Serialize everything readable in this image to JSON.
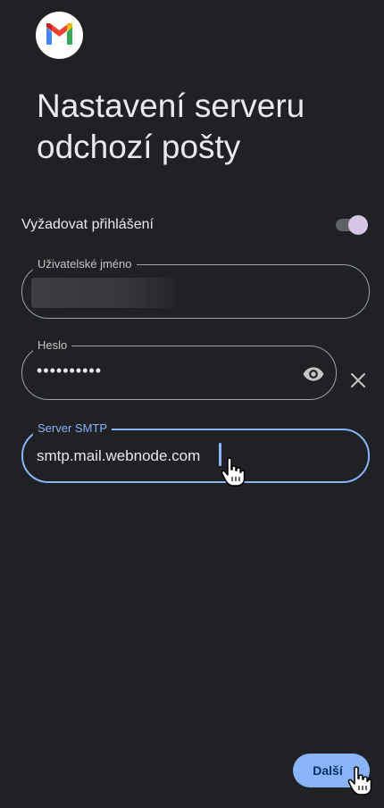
{
  "app": {
    "logo_icon": "gmail-logo-icon",
    "brand_colors": [
      "#4285f4",
      "#ea4335",
      "#fbbc04",
      "#34a853",
      "#c5221f"
    ]
  },
  "page": {
    "title": "Nastavení serveru odchozí pošty"
  },
  "require_login": {
    "label": "Vyžadovat přihlášení",
    "enabled": true
  },
  "username_field": {
    "label": "Uživatelské jméno",
    "value_redacted": true
  },
  "password_field": {
    "label": "Heslo",
    "value": "••••••••••",
    "reveal_icon": "eye-icon",
    "clear_icon": "close-icon"
  },
  "smtp_field": {
    "label": "Server SMTP",
    "value": "smtp.mail.webnode.com",
    "focused": true,
    "accent_color": "#8ab4f8"
  },
  "actions": {
    "next_label": "Další"
  },
  "theme": {
    "background": "#202124",
    "accent": "#8ab4f8",
    "toggle_thumb": "#d7c6e6"
  }
}
